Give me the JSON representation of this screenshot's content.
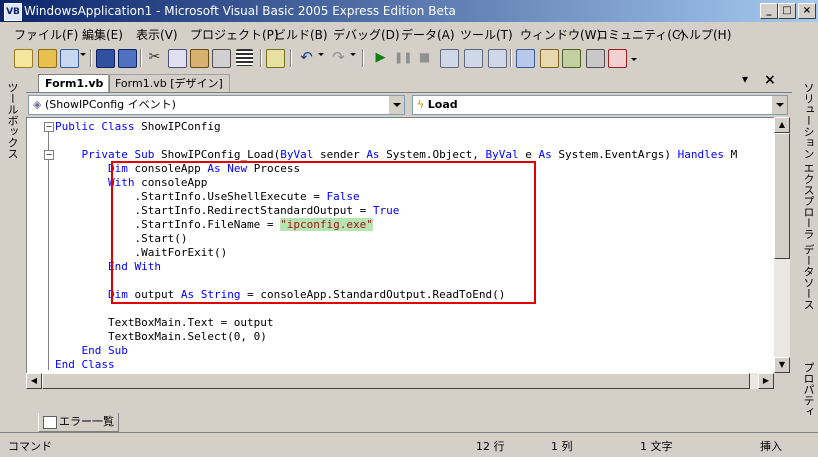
{
  "window": {
    "title": "WindowsApplication1 - Microsoft Visual Basic 2005 Express Edition Beta",
    "minimize": "_",
    "maximize": "□",
    "close": "×"
  },
  "menu": [
    "ファイル(F)",
    "編集(E)",
    "表示(V)",
    "プロジェクト(P)",
    "ビルド(B)",
    "デバッグ(D)",
    "データ(A)",
    "ツール(T)",
    "ウィンドウ(W)",
    "コミュニティ(C)",
    "ヘルプ(H)"
  ],
  "toolbar": {
    "icons": [
      "new-project-icon",
      "open-folder-icon",
      "add-item-icon",
      "save-icon",
      "save-all-icon",
      "cut-icon",
      "copy-icon",
      "paste-icon",
      "print-icon",
      "list-icon",
      "comment-icon",
      "undo-icon",
      "redo-icon",
      "start-debug-icon",
      "pause-icon",
      "stop-icon",
      "step-into-icon",
      "step-over-icon",
      "step-out-icon",
      "solution-explorer-icon",
      "properties-icon",
      "object-browser-icon",
      "toolbox-icon",
      "error-list-icon"
    ]
  },
  "tabs": [
    {
      "label": "Form1.vb",
      "active": true
    },
    {
      "label": "Form1.vb [デザイン]",
      "active": false
    }
  ],
  "tab_controls": {
    "dropdown": "▾",
    "close": "×"
  },
  "dropdowns": {
    "object": "(ShowIPConfig イベント)",
    "method": "Load"
  },
  "code": [
    [
      {
        "t": "Public Class",
        "k": "kw"
      },
      {
        "t": " ShowIPConfig"
      }
    ],
    [],
    [
      {
        "t": "    "
      },
      {
        "t": "Private Sub",
        "k": "kw"
      },
      {
        "t": " ShowIPConfig_Load("
      },
      {
        "t": "ByVal",
        "k": "kw"
      },
      {
        "t": " sender "
      },
      {
        "t": "As",
        "k": "kw"
      },
      {
        "t": " System.Object, "
      },
      {
        "t": "ByVal",
        "k": "kw"
      },
      {
        "t": " e "
      },
      {
        "t": "As",
        "k": "kw"
      },
      {
        "t": " System.EventArgs) "
      },
      {
        "t": "Handles",
        "k": "kw"
      },
      {
        "t": " M"
      }
    ],
    [
      {
        "t": "        "
      },
      {
        "t": "Dim",
        "k": "kw"
      },
      {
        "t": " consoleApp "
      },
      {
        "t": "As New",
        "k": "kw"
      },
      {
        "t": " Process"
      }
    ],
    [
      {
        "t": "        "
      },
      {
        "t": "With",
        "k": "kw"
      },
      {
        "t": " consoleApp"
      }
    ],
    [
      {
        "t": "            .StartInfo.UseShellExecute = "
      },
      {
        "t": "False",
        "k": "kw"
      }
    ],
    [
      {
        "t": "            .StartInfo.RedirectStandardOutput = "
      },
      {
        "t": "True",
        "k": "kw"
      }
    ],
    [
      {
        "t": "            .StartInfo.FileName = "
      },
      {
        "t": "\"ipconfig.exe\"",
        "k": "str"
      }
    ],
    [
      {
        "t": "            .Start()"
      }
    ],
    [
      {
        "t": "            .WaitForExit()"
      }
    ],
    [
      {
        "t": "        "
      },
      {
        "t": "End With",
        "k": "kw"
      }
    ],
    [],
    [
      {
        "t": "        "
      },
      {
        "t": "Dim",
        "k": "kw"
      },
      {
        "t": " output "
      },
      {
        "t": "As String",
        "k": "kw"
      },
      {
        "t": " = consoleApp.StandardOutput.ReadToEnd()"
      }
    ],
    [],
    [
      {
        "t": "        TextBoxMain.Text = output"
      }
    ],
    [
      {
        "t": "        TextBoxMain.Select(0, 0)"
      }
    ],
    [
      {
        "t": "    "
      },
      {
        "t": "End Sub",
        "k": "kw"
      }
    ],
    [
      {
        "t": "End Class",
        "k": "kw"
      }
    ]
  ],
  "fold_markers": {
    "collapse": "−"
  },
  "side_panels": {
    "left": "ツールボックス",
    "right": [
      "ソリューション エクスプローラ",
      "データソース",
      "プロパティ"
    ]
  },
  "error_tab": "エラー一覧",
  "status": {
    "mode": "コマンド",
    "line": "12 行",
    "col": "1 列",
    "char": "1 文字",
    "insert": "挿入"
  }
}
